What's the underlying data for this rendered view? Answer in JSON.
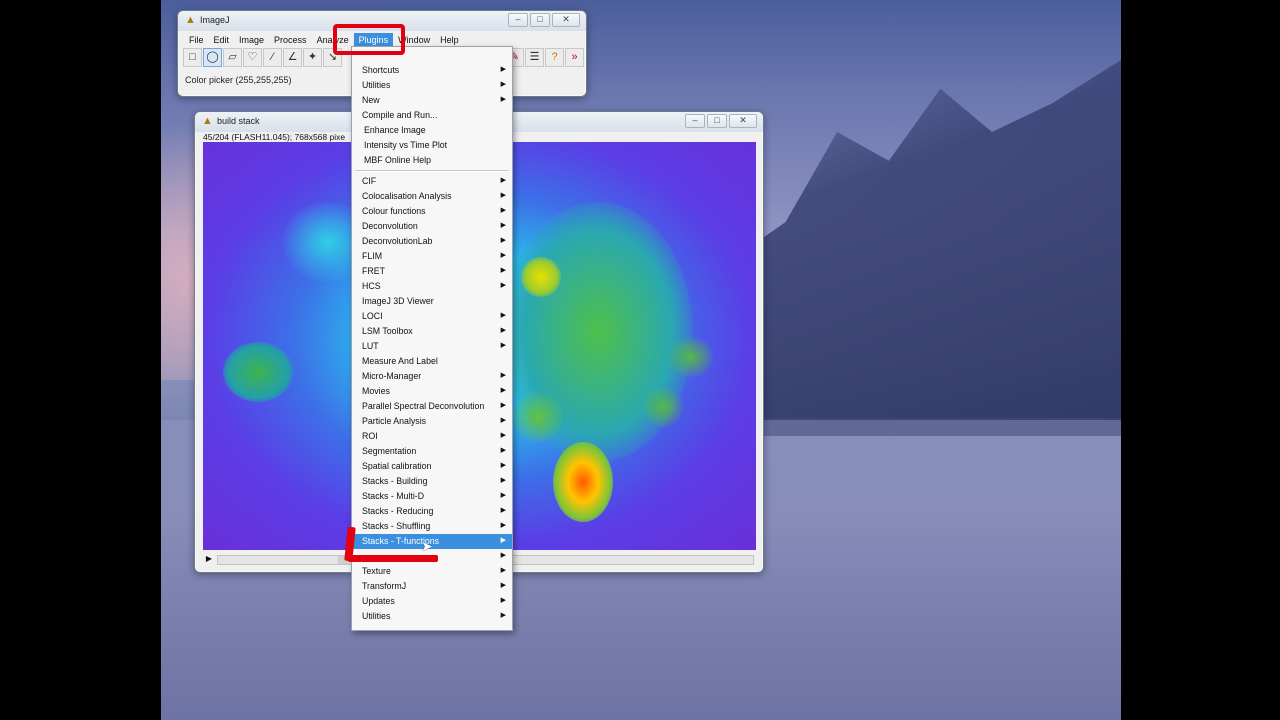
{
  "imagej": {
    "title": "ImageJ",
    "menus": [
      "File",
      "Edit",
      "Image",
      "Process",
      "Analyze",
      "Plugins",
      "Window",
      "Help"
    ],
    "active_menu": "Plugins",
    "status": "Color picker (255,255,255)",
    "tools": [
      "rectangle-tool-icon",
      "oval-tool-icon",
      "polygon-tool-icon",
      "freehand-tool-icon",
      "line-tool-icon",
      "angle-tool-icon",
      "point-tool-icon",
      "wand-tool-icon"
    ]
  },
  "stack_window": {
    "title": "build stack",
    "info": "45/204 (FLASH11.045); 768x568 pixe"
  },
  "plugins_menu": {
    "items": [
      {
        "label": "Shortcuts",
        "submenu": true
      },
      {
        "label": "Utilities",
        "submenu": true
      },
      {
        "label": "New",
        "submenu": true
      },
      {
        "label": "Compile and Run...",
        "submenu": false
      },
      {
        "label": "Enhance Image",
        "submenu": false
      },
      {
        "label": "Intensity vs Time Plot",
        "submenu": false
      },
      {
        "label": "MBF Online Help",
        "submenu": false
      },
      {
        "label": "CIF",
        "submenu": true
      },
      {
        "label": "Colocalisation Analysis",
        "submenu": true
      },
      {
        "label": "Colour functions",
        "submenu": true
      },
      {
        "label": "Deconvolution",
        "submenu": true
      },
      {
        "label": "DeconvolutionLab",
        "submenu": true
      },
      {
        "label": "FLIM",
        "submenu": true
      },
      {
        "label": "FRET",
        "submenu": true
      },
      {
        "label": "HCS",
        "submenu": true
      },
      {
        "label": "ImageJ 3D Viewer",
        "submenu": false
      },
      {
        "label": "LOCI",
        "submenu": true
      },
      {
        "label": "LSM Toolbox",
        "submenu": true
      },
      {
        "label": "LUT",
        "submenu": true
      },
      {
        "label": "Measure And Label",
        "submenu": false
      },
      {
        "label": "Micro-Manager",
        "submenu": true
      },
      {
        "label": "Movies",
        "submenu": true
      },
      {
        "label": "Parallel Spectral Deconvolution",
        "submenu": true
      },
      {
        "label": "Particle Analysis",
        "submenu": true
      },
      {
        "label": "ROI",
        "submenu": true
      },
      {
        "label": "Segmentation",
        "submenu": true
      },
      {
        "label": "Spatial calibration",
        "submenu": true
      },
      {
        "label": "Stacks - Building",
        "submenu": true
      },
      {
        "label": "Stacks - Multi-D",
        "submenu": true
      },
      {
        "label": "Stacks - Reducing",
        "submenu": true
      },
      {
        "label": "Stacks - Shuffling",
        "submenu": true
      },
      {
        "label": "Stacks - T-functions",
        "submenu": true,
        "highlighted": true
      },
      {
        "label": "",
        "submenu": true
      },
      {
        "label": "Texture",
        "submenu": true
      },
      {
        "label": "TransformJ",
        "submenu": true
      },
      {
        "label": "Updates",
        "submenu": true
      },
      {
        "label": "Utilities",
        "submenu": true
      }
    ]
  },
  "colors": {
    "highlight": "#3a8fde",
    "annotation_red": "#e3000f"
  }
}
